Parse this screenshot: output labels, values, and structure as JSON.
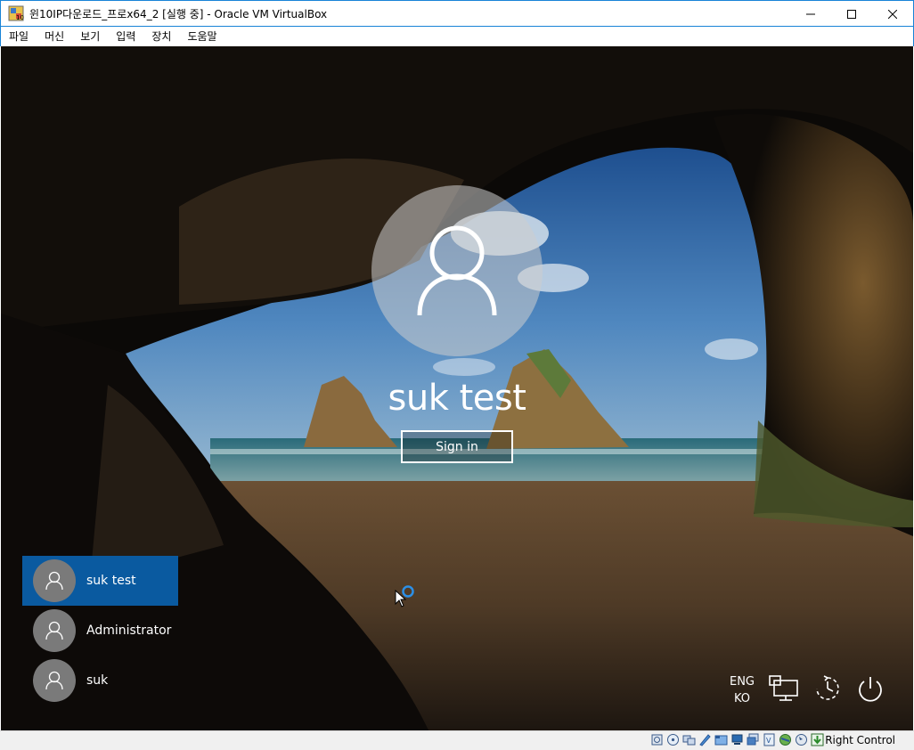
{
  "window": {
    "title": "윈10IP다운로드_프로x64_2 [실행 중] - Oracle VM VirtualBox",
    "menu": [
      "파일",
      "머신",
      "보기",
      "입력",
      "장치",
      "도움말"
    ]
  },
  "lockscreen": {
    "current_user": "suk test",
    "signin_label": "Sign in",
    "users": [
      {
        "name": "suk test",
        "selected": true
      },
      {
        "name": "Administrator",
        "selected": false
      },
      {
        "name": "suk",
        "selected": false
      }
    ],
    "language": {
      "line1": "ENG",
      "line2": "KO"
    },
    "icons": [
      "network-icon",
      "ease-of-access-icon",
      "power-icon"
    ],
    "selected_tile_color": "#0a5aa0"
  },
  "statusbar": {
    "host_key": "Right Control",
    "icons": [
      "hdd-icon",
      "optical-disk-icon",
      "audio-icon",
      "network-icon",
      "usb-icon",
      "shared-folder-icon",
      "display-icon",
      "video-capture-icon",
      "cpu-icon",
      "mouse-integration-icon",
      "keyboard-icon"
    ]
  },
  "accent_color": "#1883d7"
}
